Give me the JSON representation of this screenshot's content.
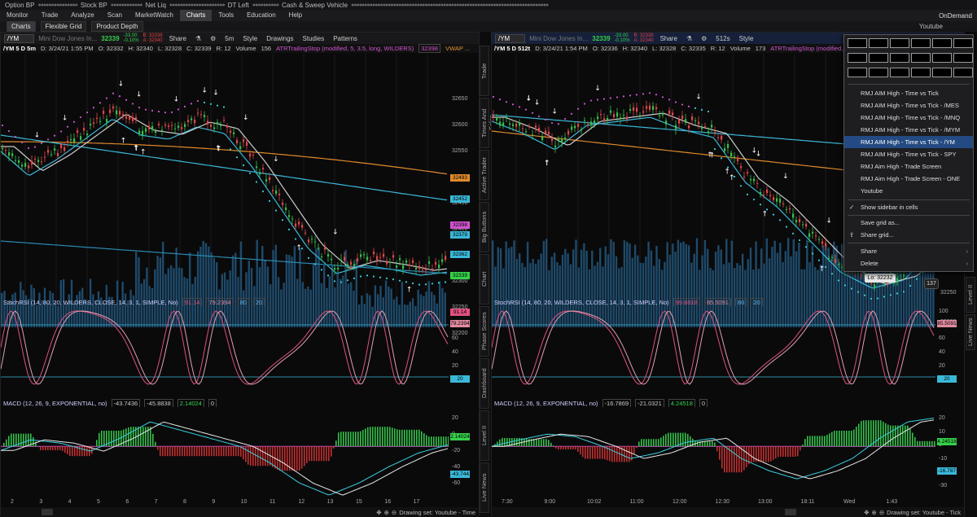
{
  "topbar": {
    "option_bp": "Option BP",
    "stock_bp": "Stock BP",
    "net_liq": "Net Liq",
    "dt_left": "DT Left",
    "cash": "Cash & Sweep Vehicle"
  },
  "menu": {
    "items": [
      "Monitor",
      "Trade",
      "Analyze",
      "Scan",
      "MarketWatch",
      "Charts",
      "Tools",
      "Education",
      "Help"
    ],
    "active": "Charts",
    "ondemand": "OnDemand"
  },
  "subbar": {
    "charts": "Charts",
    "flexible": "Flexible Grid",
    "depth": "Product Depth",
    "youtube": "Youtube"
  },
  "left": {
    "symbol": "/YM",
    "desc": "Mini Dow Jones In...",
    "last": "32339",
    "chg": "-33.00",
    "pct": "-0.10%",
    "bid": "B: 32338",
    "ask": "A: 32340",
    "share": "Share",
    "period": "5m",
    "style": "Style",
    "drawings": "Drawings",
    "studies": "Studies",
    "patterns": "Patterns",
    "info": {
      "sym": "/YM 5 D 5m",
      "d": "D: 3/24/21 1:55 PM",
      "o": "O: 32332",
      "h": "H: 32340",
      "l": "L: 32328",
      "c": "C: 32339",
      "r": "R: 12",
      "vol": "Volume",
      "volv": "156",
      "atr": "ATRTrailingStop (modified, 5, 3.5, long, WILDERS)",
      "atrv": "32398",
      "vwap": "VWAP ..."
    },
    "price_ticks": [
      "32650",
      "32600",
      "32550",
      "32500",
      "32450",
      "32400",
      "32350",
      "32300",
      "32250",
      "32200"
    ],
    "price_labels": [
      {
        "t": "32493",
        "c": "#e08a2a"
      },
      {
        "t": "32452",
        "c": "#3ab8d8"
      },
      {
        "t": "32398",
        "c": "#d055d0"
      },
      {
        "t": "32379",
        "c": "#3ab8d8"
      },
      {
        "t": "32362",
        "c": "#3ab8d8"
      },
      {
        "t": "32339",
        "c": "#35d04a"
      }
    ],
    "rsi": {
      "label": "StochRSI (14, 80, 20, WILDERS, CLOSE, 14, 3, 1, SIMPLE, No)",
      "v1": "91.14",
      "v2": "79.2394",
      "v3": "80",
      "v4": "20",
      "ticks": [
        "100",
        "80",
        "60",
        "40",
        "20",
        "0"
      ],
      "tag1": "91.14",
      "tag2": "79.2394",
      "tag3": "20"
    },
    "macd": {
      "label": "MACD (12, 26, 9, EXPONENTIAL, no)",
      "v1": "-43.7436",
      "v2": "-45.8838",
      "v3": "2.14024",
      "v4": "0",
      "ticks": [
        "20",
        "0",
        "-20",
        "-40",
        "-60"
      ],
      "tag1": "2.14024",
      "tag2": "-43.744"
    },
    "xticks": [
      "2",
      "3",
      "4",
      "5",
      "6",
      "7",
      "8",
      "9",
      "10",
      "11",
      "12",
      "13",
      "15",
      "16",
      "17"
    ],
    "drawing_set": "Drawing set: Youtube - Time"
  },
  "right": {
    "symbol": "/YM",
    "desc": "Mini Dow Jones In...",
    "last": "32339",
    "chg": "-33.00",
    "pct": "-0.10%",
    "bid": "B: 32338",
    "ask": "A: 32340",
    "share": "Share",
    "period": "512s",
    "style": "Style",
    "info": {
      "sym": "/YM 5 D 512t",
      "d": "D: 3/24/21 1:54 PM",
      "o": "O: 32336",
      "h": "H: 32340",
      "l": "L: 32328",
      "c": "C: 32335",
      "r": "R: 12",
      "vol": "Volume",
      "volv": "173",
      "atr": "ATRTrailingStop (modified, 5, 3.5, lo..."
    },
    "price_ticks": [
      "32250",
      "32200"
    ],
    "lo_label": "Lo: 32232",
    "count": "137",
    "rsi": {
      "label": "StochRSI (14, 80, 20, WILDERS, CLOSE, 14, 3, 1, SIMPLE, No)",
      "v1": "99.8818",
      "v2": "85.5091",
      "v3": "80",
      "v4": "20",
      "ticks": [
        "100",
        "80",
        "60",
        "40",
        "20",
        "0"
      ],
      "tag1": "85.5091",
      "tag2": "20"
    },
    "macd": {
      "label": "MACD (12, 26, 9, EXPONENTIAL, no)",
      "v1": "-16.7869",
      "v2": "-21.0321",
      "v3": "4.24518",
      "v4": "0",
      "ticks": [
        "20",
        "10",
        "0",
        "-10",
        "-20",
        "-30"
      ],
      "tag1": "4.24518",
      "tag2": "-16.787"
    },
    "xticks": [
      "7:30",
      "9:00",
      "10:02",
      "11:00",
      "12:00",
      "12:30",
      "13:00",
      "18:11",
      "Wed",
      "1:43"
    ],
    "drawing_set": "Drawing set: Youtube - Tick"
  },
  "sidetabs_mid": [
    "Trade",
    "Times And Sales",
    "Active Trader",
    "Big Buttons",
    "Chart",
    "Phase Scores",
    "Dashboard",
    "Level II",
    "Live News"
  ],
  "sidetabs_right": [
    "Level II",
    "Live News"
  ],
  "popup": {
    "items": [
      "RMJ AIM High - Time vs Tick",
      "RMJ AIM High - Time vs Tick - /MES",
      "RMJ AIM High - Time vs Tick - /MNQ",
      "RMJ AIM High - Time vs Tick - /MYM",
      "RMJ AIM High - Time vs Tick - /YM",
      "RMJ AIM High - Time vs Tick - SPY",
      "RMJ Aim High - Trade Screen",
      "RMJ Aim High - Trade Screen - ONE",
      "Youtube"
    ],
    "highlighted": 4,
    "show_sidebar": "Show sidebar in cells",
    "save_grid": "Save grid as...",
    "share_grid": "Share grid...",
    "share": "Share",
    "delete": "Delete"
  }
}
